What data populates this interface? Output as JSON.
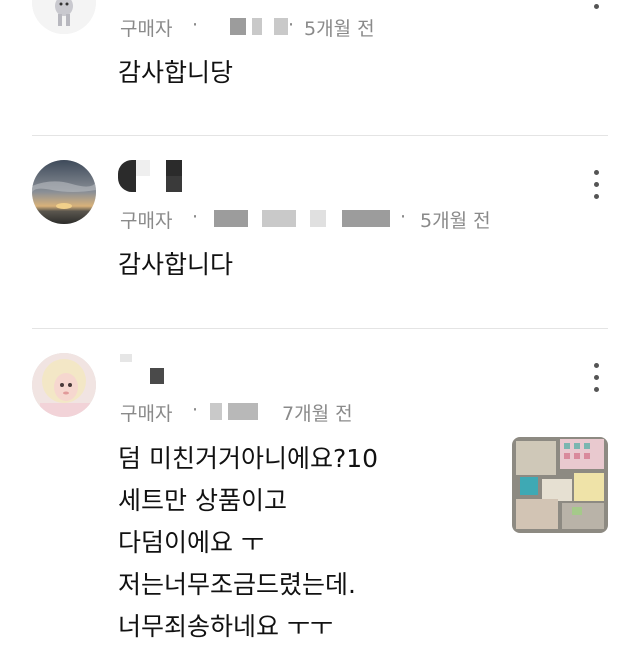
{
  "reviews": [
    {
      "meta": {
        "buyer_label": "구매자",
        "dot": "·",
        "time": "5개월 전"
      },
      "text_lines": [
        "감사합니당"
      ],
      "avatar_icon": "figurine-avatar-icon"
    },
    {
      "meta": {
        "buyer_label": "구매자",
        "dot": "·",
        "time": "5개월 전"
      },
      "text_lines": [
        "감사합니다"
      ],
      "avatar_icon": "sunset-avatar-icon"
    },
    {
      "meta": {
        "buyer_label": "구매자",
        "dot": "·",
        "time": "7개월 전"
      },
      "text_lines": [
        "덤 미친거거아니에요?10",
        "세트만 상품이고",
        "다덤이에요 ㅜ",
        "저는너무조금드렸는데.",
        "너무죄송하네요 ㅜㅜ"
      ],
      "avatar_icon": "person-avatar-icon",
      "photo_icon": "product-photo-thumbnail"
    }
  ],
  "colors": {
    "text": "#111111",
    "meta": "#8a8a8a",
    "divider": "#e4e4e4"
  }
}
